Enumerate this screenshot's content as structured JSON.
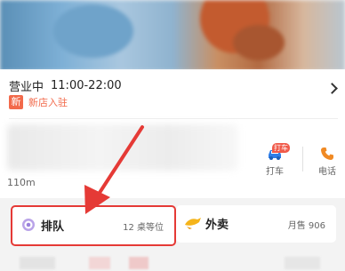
{
  "business": {
    "status": "营业中",
    "hours": "11:00-22:00",
    "new_badge": "新",
    "new_text": "新店入驻",
    "distance": "110m"
  },
  "actions": {
    "taxi_badge": "打车",
    "taxi_label": "打车",
    "phone_label": "电话"
  },
  "services": {
    "queue_label": "排队",
    "queue_status": "12 桌等位",
    "delivery_label": "外卖",
    "delivery_sales": "月售 906"
  },
  "colors": {
    "accent_red": "#e53a36",
    "new_orange": "#f26a4b",
    "taxi_blue": "#2f7ee8",
    "phone_orange": "#f08a24"
  }
}
